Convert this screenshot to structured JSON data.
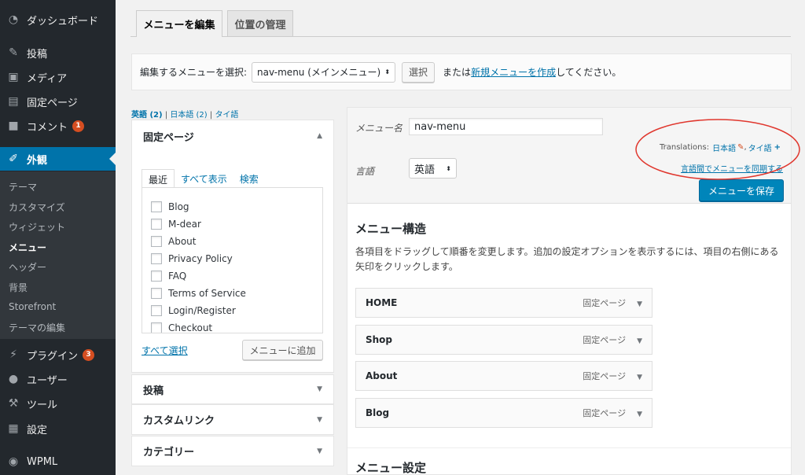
{
  "sidebar": {
    "dashboard": "ダッシュボード",
    "posts": "投稿",
    "media": "メディア",
    "pages": "固定ページ",
    "comments": "コメント",
    "comments_badge": "1",
    "appearance": "外観",
    "sub": [
      "テーマ",
      "カスタマイズ",
      "ウィジェット",
      "メニュー",
      "ヘッダー",
      "背景",
      "Storefront",
      "テーマの編集"
    ],
    "plugins": "プラグイン",
    "plugins_badge": "3",
    "users": "ユーザー",
    "tools": "ツール",
    "settings": "設定",
    "wpml": "WPML"
  },
  "tabs": {
    "edit": "メニューを編集",
    "locations": "位置の管理"
  },
  "select_bar": {
    "label": "編集するメニューを選択:",
    "selected": "nav-menu (メインメニュー)",
    "button": "選択",
    "or": "または",
    "create_link": "新規メニューを作成",
    "suffix": "してください。"
  },
  "langs": {
    "en": "英語 (2)",
    "ja": "日本語 (2)",
    "th": "タイ語",
    "sep": "|"
  },
  "pages_panel": {
    "title": "固定ページ",
    "tabs": [
      "最近",
      "すべて表示",
      "検索"
    ],
    "items": [
      "Blog",
      "M-dear",
      "About",
      "Privacy Policy",
      "FAQ",
      "Terms of Service",
      "Login/Register",
      "Checkout"
    ],
    "select_all": "すべて選択",
    "add_button": "メニューに追加"
  },
  "other_panels": {
    "posts": "投稿",
    "custom_links": "カスタムリンク",
    "categories": "カテゴリー"
  },
  "menu_header": {
    "name_label": "メニュー名",
    "name_value": "nav-menu",
    "translations_label": "Translations:",
    "trans_ja": "日本語",
    "trans_sep": ",",
    "trans_th": "タイ語",
    "plus": "+",
    "lang_label": "言語",
    "lang_value": "英語",
    "sync_link": "言語間でメニューを同期する",
    "save_button": "メニューを保存"
  },
  "structure": {
    "title": "メニュー構造",
    "desc1": "各項目をドラッグして順番を変更します。追加の設定オプションを表示するには、項目の右側にある",
    "desc2": "矢印をクリックします。",
    "items": [
      {
        "title": "HOME",
        "type": "固定ページ"
      },
      {
        "title": "Shop",
        "type": "固定ページ"
      },
      {
        "title": "About",
        "type": "固定ページ"
      },
      {
        "title": "Blog",
        "type": "固定ページ"
      }
    ],
    "settings_title": "メニュー設定"
  },
  "colors": {
    "sidebar_bg": "#23282d",
    "accent": "#0073aa",
    "primary": "#0085ba",
    "highlight_circle": "#e0372e"
  }
}
